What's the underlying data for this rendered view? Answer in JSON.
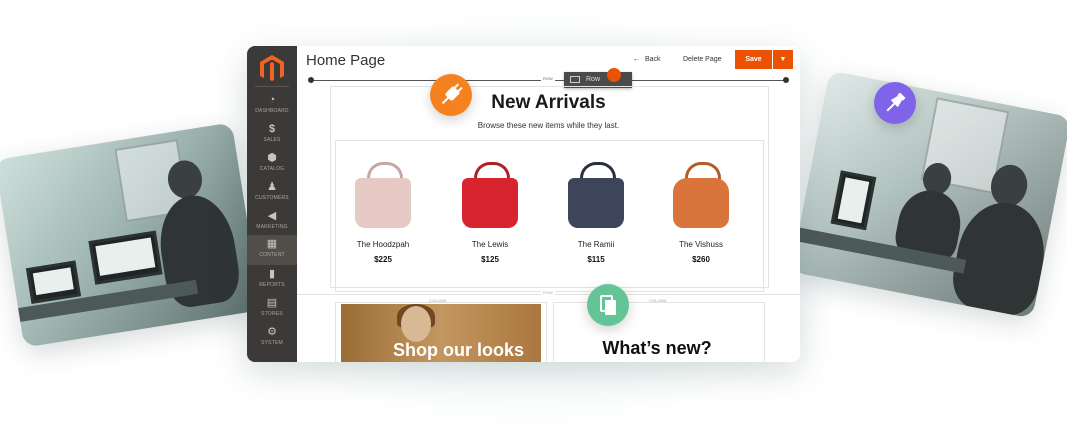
{
  "admin": {
    "page_title": "Home Page",
    "back_label": "Back",
    "delete_label": "Delete Page",
    "save_label": "Save",
    "nav": [
      {
        "label": "DASHBOARD",
        "icon": "dashboard-icon"
      },
      {
        "label": "SALES",
        "icon": "dollar-icon"
      },
      {
        "label": "CATALOG",
        "icon": "cube-icon"
      },
      {
        "label": "CUSTOMERS",
        "icon": "person-icon"
      },
      {
        "label": "MARKETING",
        "icon": "megaphone-icon"
      },
      {
        "label": "CONTENT",
        "icon": "layout-icon"
      },
      {
        "label": "REPORTS",
        "icon": "bar-chart-icon"
      },
      {
        "label": "STORES",
        "icon": "store-icon"
      },
      {
        "label": "SYSTEM",
        "icon": "gear-icon"
      }
    ],
    "active_nav": "CONTENT"
  },
  "builder": {
    "row_tag": "ROW",
    "row_tool_label": "Row",
    "column_tag": "COLUMN",
    "heading": "New Arrivals",
    "subheading": "Browse these new items while they last.",
    "products": [
      {
        "name": "The Hoodzpah",
        "price": "$225",
        "color": "#e7c9c6"
      },
      {
        "name": "The Lewis",
        "price": "$125",
        "color": "#d8242f"
      },
      {
        "name": "The Ramii",
        "price": "$115",
        "color": "#3c4559"
      },
      {
        "name": "The Vishuss",
        "price": "$260",
        "color": "#d9743a"
      }
    ],
    "banner_text": "Shop our looks",
    "whats_new": "What’s new?"
  },
  "colors": {
    "accent": "#eb5202",
    "sidebar": "#3c3a38",
    "plug_badge": "#f5821f",
    "doc_badge": "#63c596",
    "pin_badge": "#7f63e8"
  },
  "badges": [
    {
      "icon": "plug-icon"
    },
    {
      "icon": "document-icon"
    },
    {
      "icon": "pushpin-icon"
    }
  ]
}
